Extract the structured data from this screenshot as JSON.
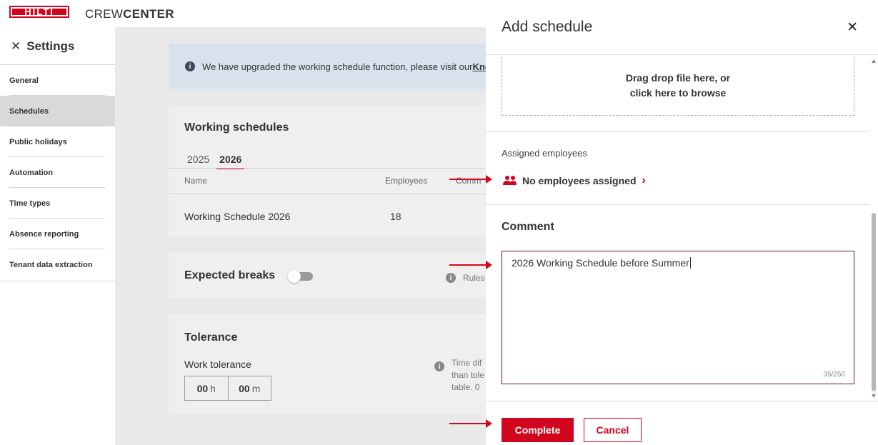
{
  "header": {
    "logo_text": "HILTI",
    "app_name_light": "CREW",
    "app_name_bold": "CENTER"
  },
  "sidebar": {
    "title": "Settings",
    "items": [
      {
        "label": "General"
      },
      {
        "label": "Schedules",
        "active": true
      },
      {
        "label": "Public holidays"
      },
      {
        "label": "Automation"
      },
      {
        "label": "Time types"
      },
      {
        "label": "Absence reporting"
      },
      {
        "label": "Tenant data extraction"
      }
    ]
  },
  "main": {
    "banner": {
      "text": "We have upgraded the working schedule function, please visit our ",
      "link": "Kno"
    },
    "working_schedules": {
      "title": "Working schedules",
      "tabs": [
        "2025",
        "2026"
      ],
      "active_tab": "2026",
      "columns": [
        "Name",
        "Employees",
        "Comm"
      ],
      "rows": [
        {
          "name": "Working Schedule 2026",
          "employees": "18"
        }
      ]
    },
    "expected_breaks": {
      "title": "Expected breaks",
      "toggle_on": false,
      "info_text": "Rules"
    },
    "tolerance": {
      "title": "Tolerance",
      "work_tolerance_label": "Work tolerance",
      "hours_value": "00",
      "hours_unit": "h",
      "minutes_value": "00",
      "minutes_unit": "m",
      "info_lines": [
        "Time dif",
        "than tole",
        "table. 0"
      ]
    }
  },
  "panel": {
    "title": "Add schedule",
    "dropzone_line1": "Drag drop file here, or",
    "dropzone_line2": "click here to browse",
    "assigned_label": "Assigned employees",
    "assigned_link": "No employees assigned",
    "comment_title": "Comment",
    "comment_value": "2026 Working Schedule before Summer",
    "comment_counter": "35/250",
    "complete_label": "Complete",
    "cancel_label": "Cancel"
  },
  "colors": {
    "brand_red": "#d2051e",
    "banner_blue": "#d8e2ec"
  }
}
